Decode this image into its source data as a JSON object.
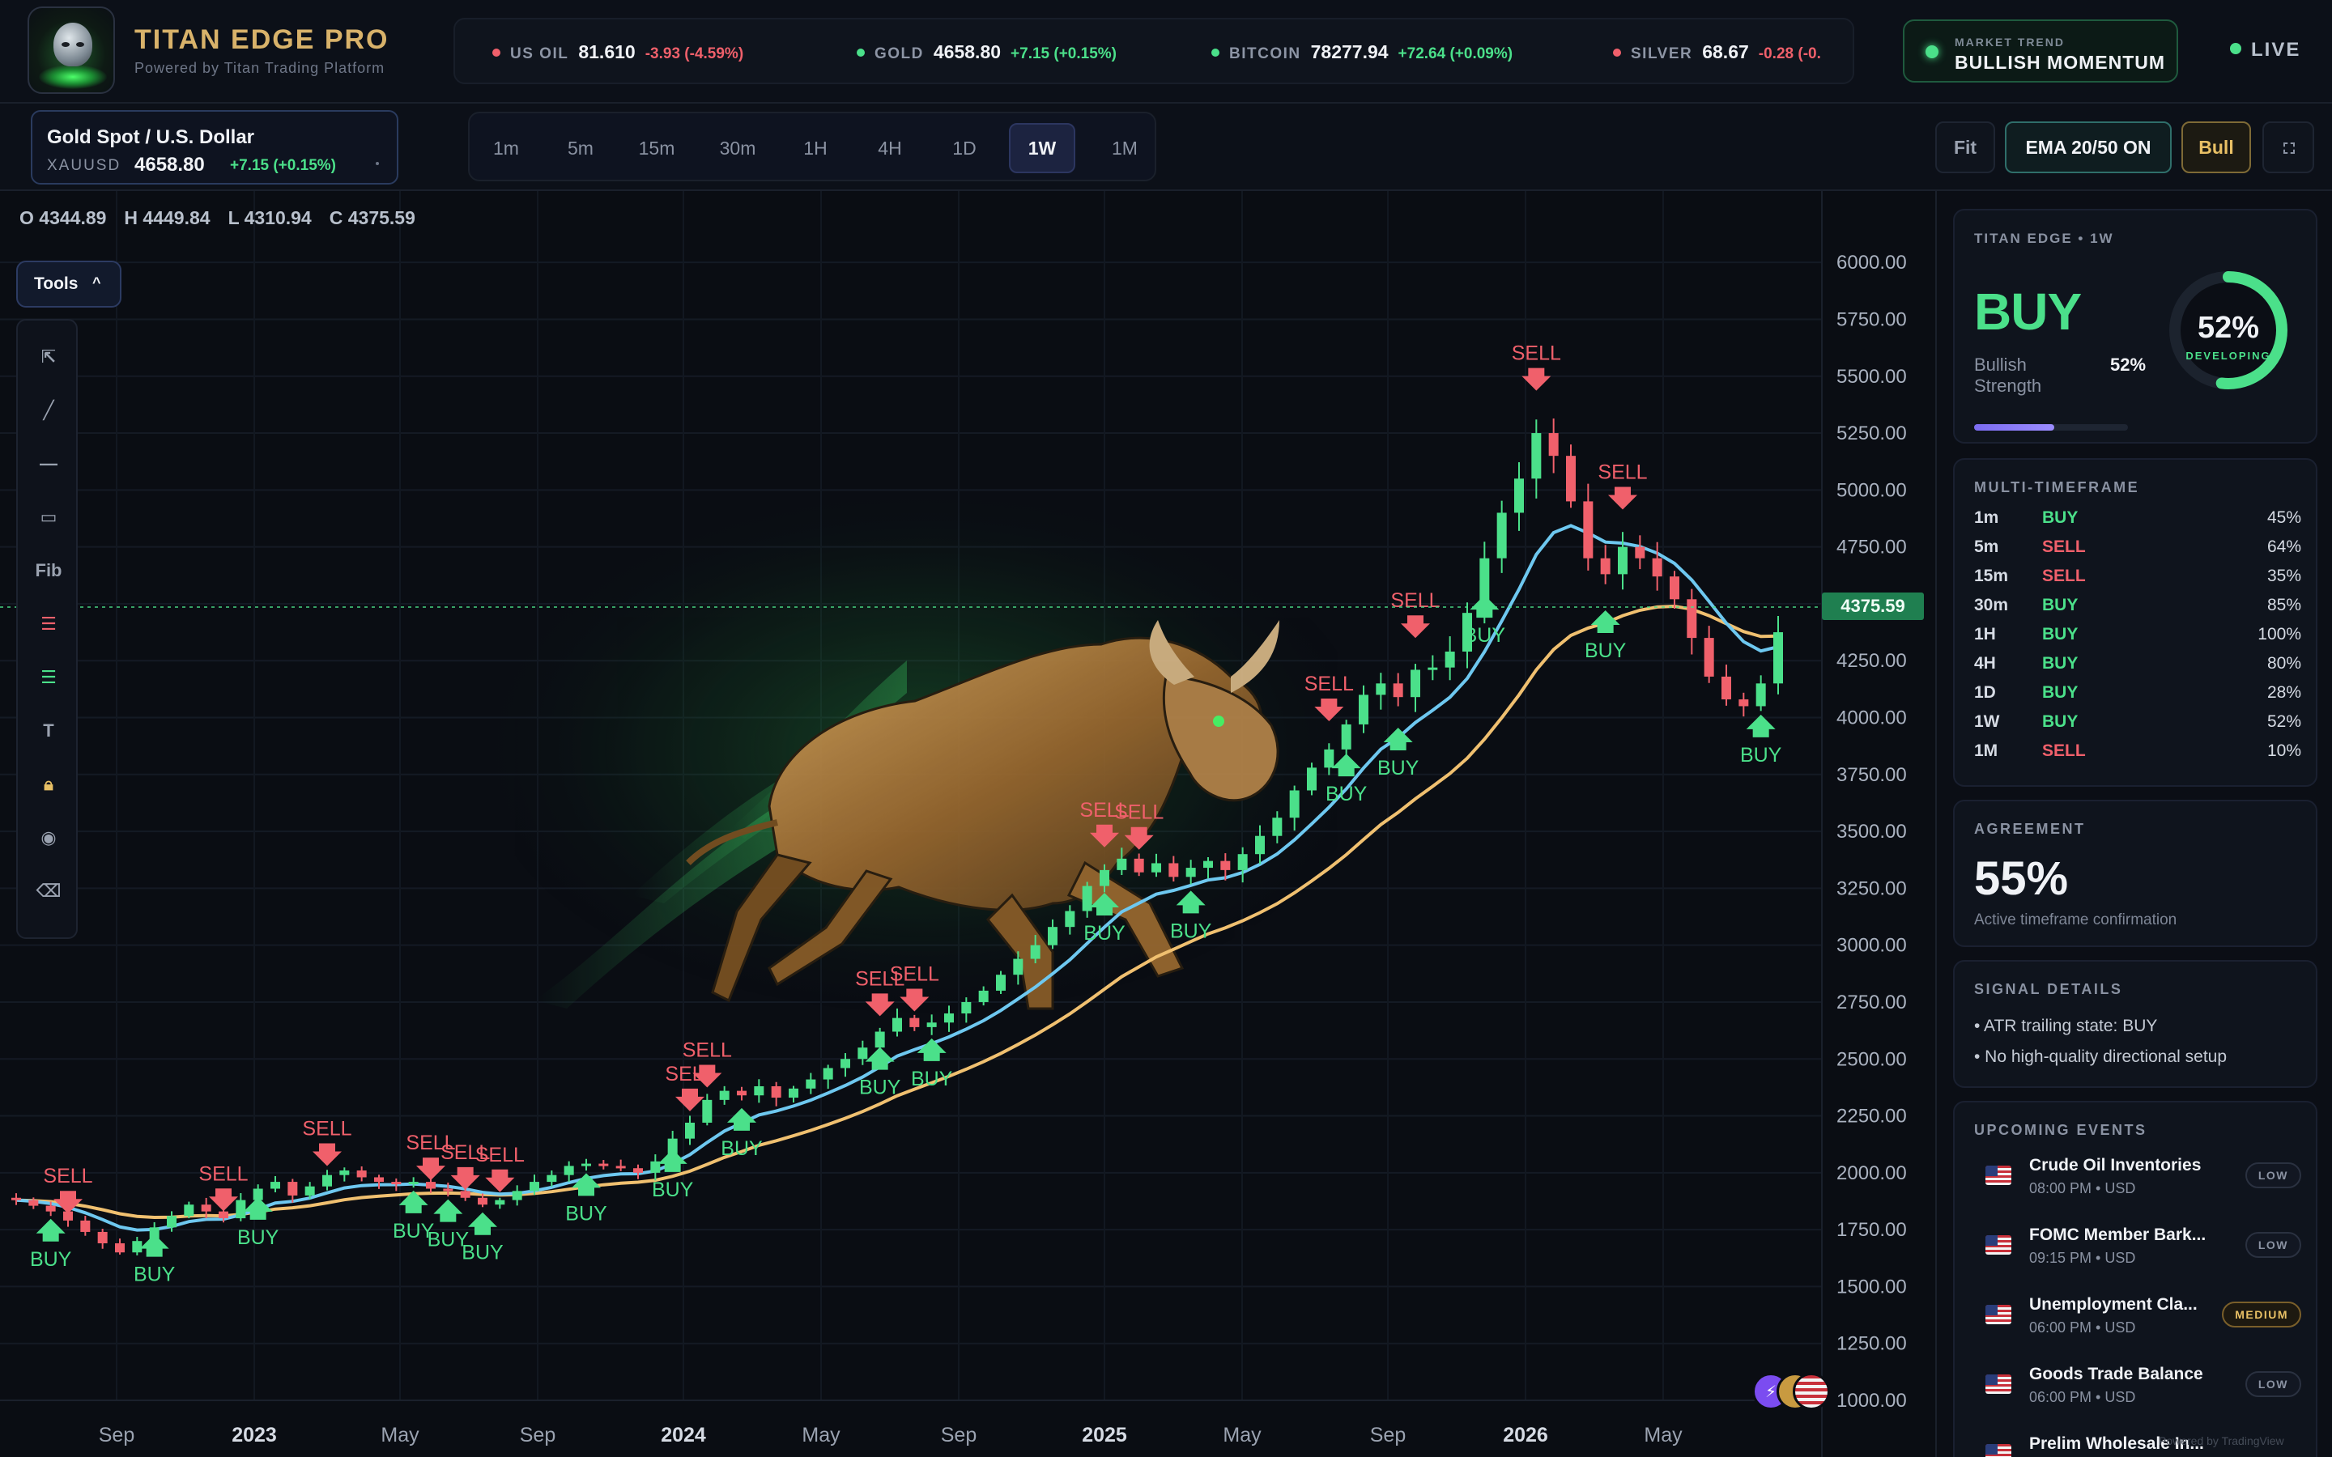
{
  "app": {
    "title": "TITAN EDGE PRO",
    "subtitle": "Powered by Titan Trading Platform",
    "live_label": "LIVE"
  },
  "tickers": [
    {
      "name": "US OIL",
      "price": "81.610",
      "change": "-3.93 (-4.59%)",
      "direction": "down"
    },
    {
      "name": "GOLD",
      "price": "4658.80",
      "change": "+7.15 (+0.15%)",
      "direction": "up"
    },
    {
      "name": "BITCOIN",
      "price": "78277.94",
      "change": "+72.64 (+0.09%)",
      "direction": "up"
    },
    {
      "name": "SILVER",
      "price": "68.67",
      "change": "-0.28 (-0.",
      "direction": "down"
    }
  ],
  "market_trend": {
    "label": "MARKET TREND",
    "value": "BULLISH MOMENTUM"
  },
  "symbol": {
    "name": "Gold Spot / U.S. Dollar",
    "ticker": "XAUUSD",
    "price": "4658.80",
    "change": "+7.15 (+0.15%)"
  },
  "timeframes": {
    "items": [
      "1m",
      "5m",
      "15m",
      "30m",
      "1H",
      "4H",
      "1D",
      "1W",
      "1M"
    ],
    "active": "1W"
  },
  "toolbar": {
    "fit": "Fit",
    "ema": "EMA 20/50 ON",
    "bull": "Bull",
    "fullscreen_icon": "fullscreen-icon"
  },
  "ohlc": {
    "o": "O 4344.89",
    "h": "H 4449.84",
    "l": "L 4310.94",
    "c": "C 4375.59"
  },
  "tools": {
    "label": "Tools",
    "items": [
      "cursor-arrow-icon",
      "trend-line-icon",
      "horizontal-line-icon",
      "rectangle-icon",
      "Fib",
      "long-position-icon",
      "short-position-icon",
      "T",
      "lock-icon",
      "eye-icon",
      "eraser-icon"
    ]
  },
  "colors": {
    "up": "#4be08a",
    "down": "#f0606b",
    "ema20": "#6ec8f0",
    "ema50": "#f0c070",
    "buy": "#4be08a",
    "sell": "#f0606b",
    "accent_gold": "#d8b26a"
  },
  "chart_data": {
    "type": "candlestick",
    "symbol": "XAUUSD",
    "interval": "1W",
    "y_ticks": [
      "6000.00",
      "5750.00",
      "5500.00",
      "5250.00",
      "5000.00",
      "4750.00",
      "4500.00",
      "4250.00",
      "4000.00",
      "3750.00",
      "3500.00",
      "3250.00",
      "3000.00",
      "2750.00",
      "2500.00",
      "2250.00",
      "2000.00",
      "1750.00",
      "1500.00",
      "1250.00",
      "1000.00"
    ],
    "ylim": [
      1000,
      6150
    ],
    "x_ticks": [
      "Sep",
      "2023",
      "May",
      "Sep",
      "2024",
      "May",
      "Sep",
      "2025",
      "May",
      "Sep",
      "2026",
      "May"
    ],
    "last_price": 4375.59,
    "last_price_label": "4375.59",
    "series_close": [
      1880,
      1855,
      1830,
      1790,
      1740,
      1690,
      1650,
      1700,
      1760,
      1810,
      1860,
      1830,
      1800,
      1880,
      1930,
      1960,
      1900,
      1940,
      1990,
      2010,
      1980,
      1960,
      1950,
      1960,
      1930,
      1920,
      1890,
      1860,
      1880,
      1920,
      1960,
      1990,
      2030,
      2040,
      2030,
      2020,
      2000,
      2050,
      2150,
      2220,
      2320,
      2360,
      2340,
      2380,
      2330,
      2370,
      2410,
      2460,
      2500,
      2550,
      2620,
      2680,
      2640,
      2660,
      2700,
      2750,
      2800,
      2870,
      2940,
      3000,
      3080,
      3150,
      3260,
      3330,
      3380,
      3320,
      3360,
      3300,
      3340,
      3370,
      3330,
      3400,
      3480,
      3560,
      3680,
      3780,
      3860,
      3970,
      4100,
      4150,
      4090,
      4210,
      4220,
      4290,
      4460,
      4700,
      4900,
      5050,
      5250,
      5150,
      4950,
      4700,
      4630,
      4750,
      4700,
      4620,
      4520,
      4350,
      4180,
      4080,
      4050,
      4150,
      4375
    ],
    "ema20_label": "EMA 20",
    "ema50_label": "EMA 50",
    "signals": [
      {
        "type": "SELL",
        "x": 3
      },
      {
        "type": "BUY",
        "x": 2
      },
      {
        "type": "BUY",
        "x": 8
      },
      {
        "type": "SELL",
        "x": 12
      },
      {
        "type": "BUY",
        "x": 14
      },
      {
        "type": "SELL",
        "x": 18
      },
      {
        "type": "SELL",
        "x": 24
      },
      {
        "type": "BUY",
        "x": 23
      },
      {
        "type": "SELL",
        "x": 26
      },
      {
        "type": "BUY",
        "x": 25
      },
      {
        "type": "SELL",
        "x": 28
      },
      {
        "type": "BUY",
        "x": 27
      },
      {
        "type": "SELL",
        "x": 39
      },
      {
        "type": "BUY",
        "x": 33
      },
      {
        "type": "SELL",
        "x": 40
      },
      {
        "type": "BUY",
        "x": 38
      },
      {
        "type": "BUY",
        "x": 42
      },
      {
        "type": "SELL",
        "x": 50
      },
      {
        "type": "SELL",
        "x": 52
      },
      {
        "type": "BUY",
        "x": 50
      },
      {
        "type": "BUY",
        "x": 53
      },
      {
        "type": "SELL",
        "x": 63
      },
      {
        "type": "SELL",
        "x": 65
      },
      {
        "type": "BUY",
        "x": 63
      },
      {
        "type": "BUY",
        "x": 68
      },
      {
        "type": "SELL",
        "x": 76
      },
      {
        "type": "BUY",
        "x": 77
      },
      {
        "type": "BUY",
        "x": 80
      },
      {
        "type": "SELL",
        "x": 81
      },
      {
        "type": "SELL",
        "x": 88
      },
      {
        "type": "BUY",
        "x": 85
      },
      {
        "type": "SELL",
        "x": 93
      },
      {
        "type": "BUY",
        "x": 92
      },
      {
        "type": "BUY",
        "x": 101
      }
    ]
  },
  "signal_card": {
    "title": "TITAN EDGE • 1W",
    "signal": "BUY",
    "strength_label": "Bullish Strength",
    "strength_value": "52%",
    "strength_fraction": 0.52,
    "gauge_value": "52%",
    "gauge_label": "DEVELOPING"
  },
  "multi_timeframe": {
    "title": "MULTI-TIMEFRAME",
    "rows": [
      {
        "tf": "1m",
        "signal": "BUY",
        "pct": "45%"
      },
      {
        "tf": "5m",
        "signal": "SELL",
        "pct": "64%"
      },
      {
        "tf": "15m",
        "signal": "SELL",
        "pct": "35%"
      },
      {
        "tf": "30m",
        "signal": "BUY",
        "pct": "85%"
      },
      {
        "tf": "1H",
        "signal": "BUY",
        "pct": "100%"
      },
      {
        "tf": "4H",
        "signal": "BUY",
        "pct": "80%"
      },
      {
        "tf": "1D",
        "signal": "BUY",
        "pct": "28%"
      },
      {
        "tf": "1W",
        "signal": "BUY",
        "pct": "52%"
      },
      {
        "tf": "1M",
        "signal": "SELL",
        "pct": "10%"
      }
    ]
  },
  "agreement": {
    "title": "AGREEMENT",
    "value": "55%",
    "subtitle": "Active timeframe confirmation"
  },
  "signal_details": {
    "title": "SIGNAL DETAILS",
    "items": [
      "• ATR trailing state: BUY",
      "• No high-quality directional setup"
    ]
  },
  "events": {
    "title": "UPCOMING EVENTS",
    "items": [
      {
        "name": "Crude Oil Inventories",
        "meta": "08:00 PM • USD",
        "impact": "LOW"
      },
      {
        "name": "FOMC Member Bark...",
        "meta": "09:15 PM • USD",
        "impact": "LOW"
      },
      {
        "name": "Unemployment Cla...",
        "meta": "06:00 PM • USD",
        "impact": "MEDIUM"
      },
      {
        "name": "Goods Trade Balance",
        "meta": "06:00 PM • USD",
        "impact": "LOW"
      },
      {
        "name": "Prelim Wholesale In...",
        "meta": "",
        "impact": ""
      }
    ]
  },
  "footer": {
    "powered": "Powered by TradingView"
  }
}
